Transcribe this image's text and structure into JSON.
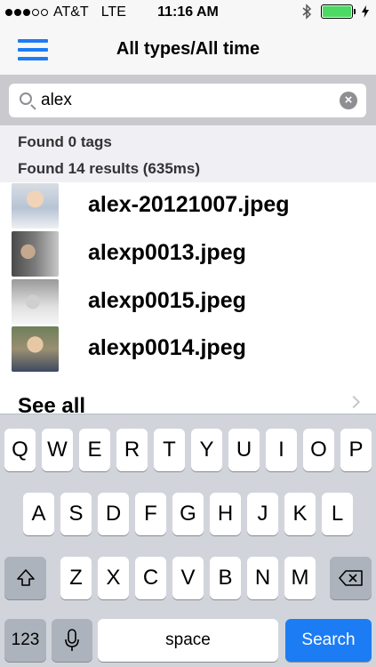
{
  "status": {
    "carrier": "AT&T",
    "network": "LTE",
    "time": "11:16 AM",
    "signal_bars": 3,
    "signal_total": 5,
    "bluetooth_icon": "bluetooth-icon",
    "battery_level": 1.0,
    "battery_color": "#4cd964"
  },
  "nav": {
    "menu_icon": "hamburger-menu-icon",
    "title": "All types/All time",
    "accent": "#1c7cf4"
  },
  "search": {
    "value": "alex",
    "placeholder": "",
    "clear_icon": "clear-icon"
  },
  "info": {
    "tags_line": "Found 0 tags",
    "results_line": "Found 14 results (635ms)"
  },
  "results": [
    {
      "name": "alex-20121007.jpeg"
    },
    {
      "name": "alexp0013.jpeg"
    },
    {
      "name": "alexp0015.jpeg"
    },
    {
      "name": "alexp0014.jpeg"
    }
  ],
  "see_all": {
    "label": "See all",
    "icon": "chevron-right-icon"
  },
  "keyboard": {
    "row1": [
      "Q",
      "W",
      "E",
      "R",
      "T",
      "Y",
      "U",
      "I",
      "O",
      "P"
    ],
    "row2": [
      "A",
      "S",
      "D",
      "F",
      "G",
      "H",
      "J",
      "K",
      "L"
    ],
    "row3": [
      "Z",
      "X",
      "C",
      "V",
      "B",
      "N",
      "M"
    ],
    "numbers_label": "123",
    "space_label": "space",
    "search_label": "Search",
    "shift_icon": "shift-icon",
    "backspace_icon": "backspace-icon",
    "mic_icon": "microphone-icon"
  }
}
